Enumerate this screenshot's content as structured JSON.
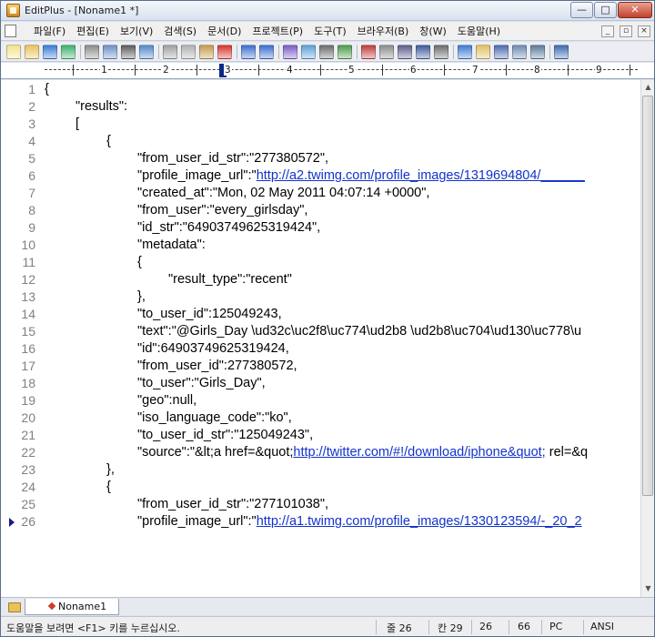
{
  "window": {
    "title": "EditPlus - [Noname1 *]",
    "controls": {
      "minimize": "—",
      "maximize": "□",
      "close": "✕"
    }
  },
  "menu": {
    "items": [
      "파일(F)",
      "편집(E)",
      "보기(V)",
      "검색(S)",
      "문서(D)",
      "프로젝트(P)",
      "도구(T)",
      "브라우저(B)",
      "창(W)",
      "도움말(H)"
    ],
    "mdi_controls": [
      "_",
      "▫",
      "×"
    ]
  },
  "toolbar": {
    "icons": [
      "new-file-icon",
      "open-file-icon",
      "save-icon",
      "save-all-icon",
      "print-icon",
      "print-preview-icon",
      "spellcheck-icon",
      "browser-preview-icon",
      "cut-icon",
      "copy-icon",
      "paste-icon",
      "delete-icon",
      "undo-icon",
      "redo-icon",
      "find-icon",
      "replace-icon",
      "select-all-icon",
      "indent-icon",
      "font-icon",
      "hex-icon",
      "word-wrap-icon",
      "line-number-icon",
      "ruler-icon",
      "spell-icon",
      "directory-window-icon",
      "output-window-icon",
      "cliptext-icon",
      "fullscreen-icon",
      "context-help-icon"
    ]
  },
  "ruler": {
    "numbers": [
      "1",
      "2",
      "3",
      "4",
      "5",
      "6",
      "7",
      "8",
      "9"
    ]
  },
  "editor": {
    "lines": [
      {
        "n": "1",
        "indent": 0,
        "parts": [
          {
            "t": "{"
          }
        ]
      },
      {
        "n": "2",
        "indent": 1,
        "parts": [
          {
            "t": "\"results\":"
          }
        ]
      },
      {
        "n": "3",
        "indent": 1,
        "parts": [
          {
            "t": "["
          }
        ]
      },
      {
        "n": "4",
        "indent": 2,
        "parts": [
          {
            "t": "{"
          }
        ]
      },
      {
        "n": "5",
        "indent": 3,
        "parts": [
          {
            "t": "\"from_user_id_str\":\"277380572\","
          }
        ]
      },
      {
        "n": "6",
        "indent": 3,
        "parts": [
          {
            "t": "\"profile_image_url\":\""
          },
          {
            "t": "http://a2.twimg.com/profile_images/1319694804/______",
            "link": true
          }
        ]
      },
      {
        "n": "7",
        "indent": 3,
        "parts": [
          {
            "t": "\"created_at\":\"Mon, 02 May 2011 04:07:14 +0000\","
          }
        ]
      },
      {
        "n": "8",
        "indent": 3,
        "parts": [
          {
            "t": "\"from_user\":\"every_girlsday\","
          }
        ]
      },
      {
        "n": "9",
        "indent": 3,
        "parts": [
          {
            "t": "\"id_str\":\"64903749625319424\","
          }
        ]
      },
      {
        "n": "10",
        "indent": 3,
        "parts": [
          {
            "t": "\"metadata\":"
          }
        ]
      },
      {
        "n": "11",
        "indent": 3,
        "parts": [
          {
            "t": "{"
          }
        ]
      },
      {
        "n": "12",
        "indent": 4,
        "parts": [
          {
            "t": "\"result_type\":\"recent\""
          }
        ]
      },
      {
        "n": "13",
        "indent": 3,
        "parts": [
          {
            "t": "},"
          }
        ]
      },
      {
        "n": "14",
        "indent": 3,
        "parts": [
          {
            "t": "\"to_user_id\":125049243,"
          }
        ]
      },
      {
        "n": "15",
        "indent": 3,
        "parts": [
          {
            "t": "\"text\":\"@Girls_Day \\ud32c\\uc2f8\\uc774\\ud2b8 \\ud2b8\\uc704\\ud130\\uc778\\u"
          }
        ]
      },
      {
        "n": "16",
        "indent": 3,
        "parts": [
          {
            "t": "\"id\":64903749625319424,"
          }
        ]
      },
      {
        "n": "17",
        "indent": 3,
        "parts": [
          {
            "t": "\"from_user_id\":277380572,"
          }
        ]
      },
      {
        "n": "18",
        "indent": 3,
        "parts": [
          {
            "t": "\"to_user\":\"Girls_Day\","
          }
        ]
      },
      {
        "n": "19",
        "indent": 3,
        "parts": [
          {
            "t": "\"geo\":null,"
          }
        ]
      },
      {
        "n": "20",
        "indent": 3,
        "parts": [
          {
            "t": "\"iso_language_code\":\"ko\","
          }
        ]
      },
      {
        "n": "21",
        "indent": 3,
        "parts": [
          {
            "t": "\"to_user_id_str\":\"125049243\","
          }
        ]
      },
      {
        "n": "22",
        "indent": 3,
        "parts": [
          {
            "t": "\"source\":\"&lt;a href=&quot;"
          },
          {
            "t": "http://twitter.com/#!/download/iphone&quot;",
            "link": true
          },
          {
            "t": " rel=&q"
          }
        ]
      },
      {
        "n": "23",
        "indent": 2,
        "parts": [
          {
            "t": "},"
          }
        ]
      },
      {
        "n": "24",
        "indent": 2,
        "parts": [
          {
            "t": "{"
          }
        ]
      },
      {
        "n": "25",
        "indent": 3,
        "parts": [
          {
            "t": "\"from_user_id_str\":\"277101038\","
          }
        ]
      },
      {
        "n": "26",
        "indent": 3,
        "parts": [
          {
            "t": "\"profile_image_url\":\""
          },
          {
            "t": "http://a1.twimg.com/profile_images/1330123594/-_20_2",
            "link": true
          }
        ],
        "current": true
      }
    ]
  },
  "tabs": {
    "active": "Noname1"
  },
  "status": {
    "hint": "도움말을 보려면 <F1> 키를 누르십시오.",
    "line": "줄 26",
    "col": "칸 29",
    "total_lines": "26",
    "chars": "66",
    "format": "PC",
    "encoding": "ANSI"
  }
}
